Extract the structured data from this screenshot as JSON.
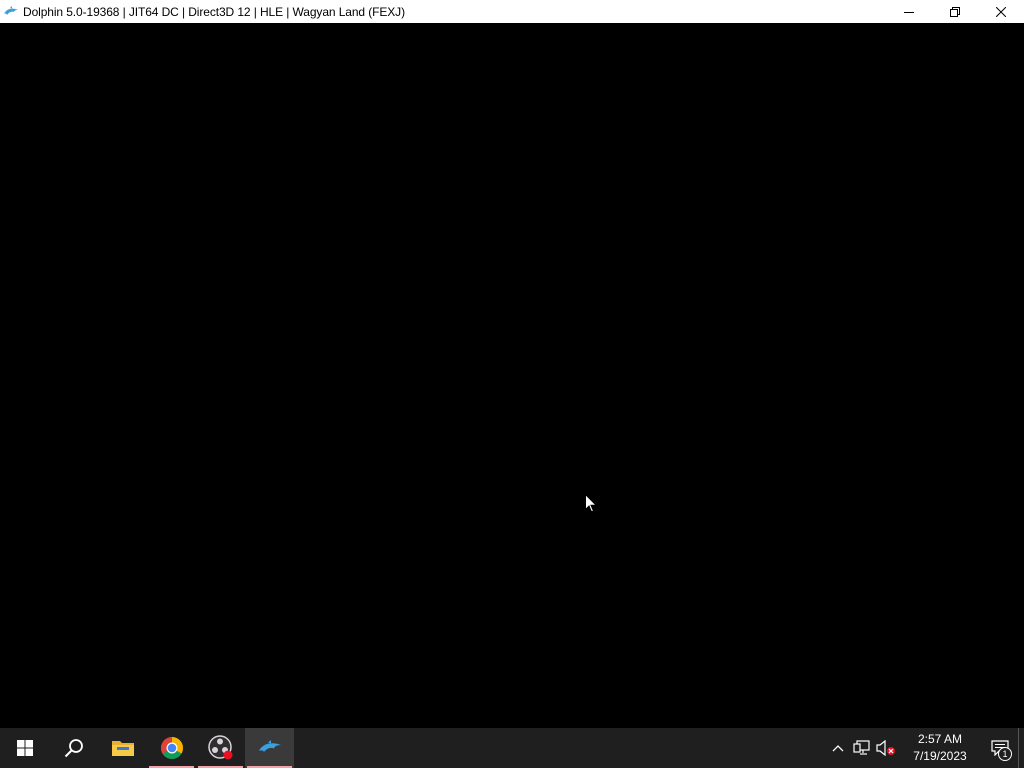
{
  "window": {
    "title": "Dolphin 5.0-19368 | JIT64 DC | Direct3D 12 | HLE | Wagyan Land (FEXJ)",
    "app_icon": "dolphin-icon",
    "controls": [
      "minimize-icon",
      "restore-icon",
      "close-icon"
    ]
  },
  "viewport": {
    "background": "#000000"
  },
  "taskbar": {
    "items": [
      {
        "name": "start",
        "icon": "windows-logo-icon"
      },
      {
        "name": "search",
        "icon": "search-icon"
      },
      {
        "name": "file-explorer",
        "icon": "folder-icon"
      },
      {
        "name": "chrome",
        "icon": "chrome-icon"
      },
      {
        "name": "obs",
        "icon": "obs-icon"
      },
      {
        "name": "dolphin",
        "icon": "dolphin-icon"
      }
    ],
    "running_indicator_color": "#f2a2a8",
    "tray": {
      "icons": [
        "chevron-up-icon",
        "network-icon",
        "speaker-muted-icon"
      ],
      "time": "2:57 AM",
      "date": "7/19/2023",
      "notification_count": "1"
    }
  }
}
